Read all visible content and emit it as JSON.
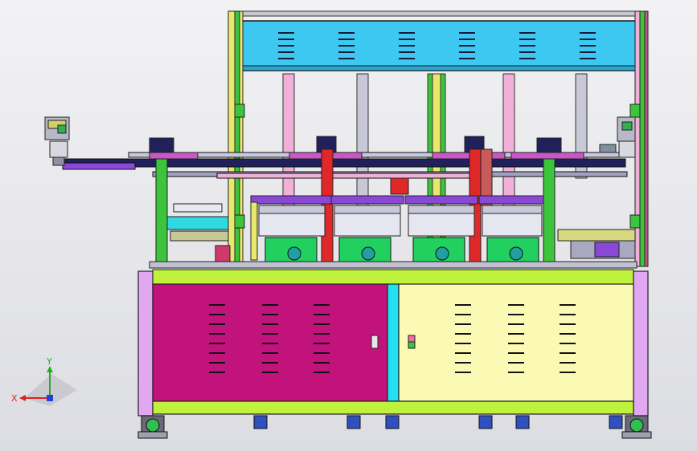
{
  "triad": {
    "x_label": "X",
    "y_label": "Y"
  },
  "colors": {
    "background_top": "#f2f2f4",
    "background_bottom": "#dcdde2",
    "frame_yellow": "#e8e86a",
    "frame_green": "#3cc43c",
    "top_panel_cyan": "#3cc8f0",
    "cabinet_lime": "#bff23c",
    "door_magenta": "#c2127c",
    "door_cream": "#fafab4",
    "side_violet": "#e0a8f0",
    "strip_cyan": "#22e0f0",
    "motor_green": "#22d060",
    "rail_navy": "#20205a",
    "column_pink": "#f0b0d8",
    "column_grey": "#c8c8d8",
    "purple_part": "#8a48d8",
    "red_part": "#e02828",
    "foot_blue": "#3050c0",
    "axis_x": "#e02020",
    "axis_y": "#20b020",
    "axis_z": "#2040e0"
  }
}
